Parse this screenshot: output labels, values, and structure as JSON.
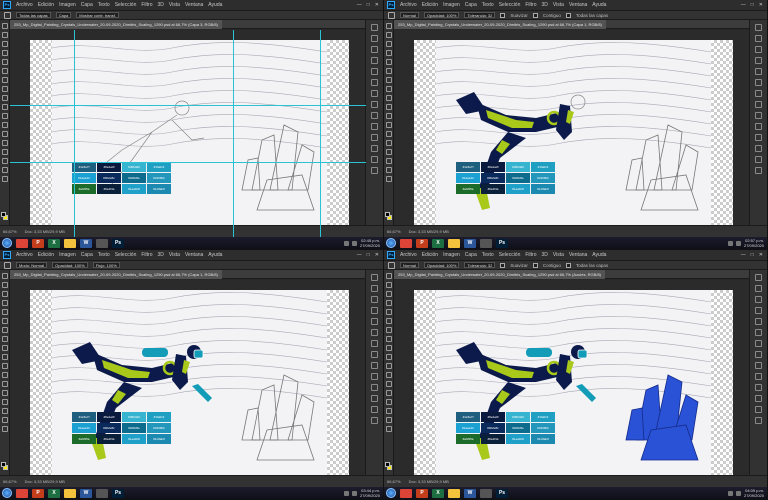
{
  "app": {
    "menu": [
      "Archivo",
      "Edición",
      "Imagen",
      "Capa",
      "Texto",
      "Selección",
      "Filtro",
      "3D",
      "Vista",
      "Ventana",
      "Ayuda"
    ],
    "window_controls": [
      "—",
      "□",
      "✕"
    ],
    "logo": "Ps"
  },
  "panes": [
    {
      "options": {
        "tool_label": "Todas las capas",
        "field1": "Capa",
        "field2": "Mostrar contr. transf."
      },
      "doc_tab": "253_Mp_Digital_Painting_Crystals_Underwater_20-09-2020_Dimitris_Scaling_1290.psd al 66,7% (Capa 3, RGB/8)",
      "zoom": "66,67%",
      "status": "Doc: 3,33 MB/29,9 MB",
      "time": "02:45 p.m.",
      "date": "27/09/2020"
    },
    {
      "options": {
        "tool_label": "Normal",
        "field1": "Opacidad: 100%",
        "field2": "Tolerancia: 32"
      },
      "checks": [
        "Suavizar",
        "Contiguo",
        "Todas las capas"
      ],
      "doc_tab": "253_Mp_Digital_Painting_Crystals_Underwater_20-09-2020_Dimitris_Scaling_1290.psd al 66,7% (Capa 1, RGB/8)",
      "zoom": "66,67%",
      "status": "Doc: 3,33 MB/29,9 MB",
      "time": "02:57 p.m.",
      "date": "27/09/2020"
    },
    {
      "options": {
        "tool_label": "Modo: Normal",
        "field1": "Opacidad: 100%",
        "field2": "Flujo: 100%"
      },
      "doc_tab": "253_Mp_Digital_Painting_Crystals_Underwater_20-09-2020_Dimitris_Scaling_1290.psd al 66,7% (Capa 1, RGB/8)",
      "zoom": "66,67%",
      "status": "Doc: 3,33 MB/29,9 MB",
      "time": "03:44 p.m.",
      "date": "27/09/2020"
    },
    {
      "options": {
        "tool_label": "Normal",
        "field1": "Opacidad: 100%",
        "field2": "Tolerancia: 32"
      },
      "checks": [
        "Suavizar",
        "Contiguo",
        "Todas las capas"
      ],
      "doc_tab": "253_Mp_Digital_Painting_Crystals_Underwater_20-09-2020_Dimitris_Scaling_1290.psd al 66,7% (Azules, RGB/8)",
      "zoom": "66,67%",
      "status": "Doc: 3,33 MB/29,9 MB",
      "time": "04:09 p.m.",
      "date": "27/09/2020"
    }
  ],
  "palette": [
    {
      "code": "#1e5e7f",
      "color": "#1e5e7f"
    },
    {
      "code": "#0a1a3f",
      "color": "#0a1a3f"
    },
    {
      "code": "#36b4d0",
      "color": "#36b4d0"
    },
    {
      "code": "#1fa0c3",
      "color": "#1fa0c3"
    },
    {
      "code": "#1aa1d2",
      "color": "#1aa1d2"
    },
    {
      "code": "#0b2a5c",
      "color": "#0b2a5c"
    },
    {
      "code": "#0d6c8e",
      "color": "#0d6c8e"
    },
    {
      "code": "#2296bb",
      "color": "#2296bb"
    },
    {
      "code": "#a4f45a",
      "color": "#1d6b2a"
    },
    {
      "code": "#0a1f3a",
      "color": "#0a1f3a"
    },
    {
      "code": "#1ea0c8",
      "color": "#1ea0c8"
    },
    {
      "code": "#1c8ab0",
      "color": "#1c8ab0"
    }
  ],
  "taskbar_icons": [
    {
      "name": "chrome",
      "label": "",
      "color": "#db4437"
    },
    {
      "name": "powerpoint",
      "label": "P",
      "color": "#c43e1c"
    },
    {
      "name": "excel",
      "label": "X",
      "color": "#1d6f42"
    },
    {
      "name": "explorer",
      "label": "",
      "color": "#f3c23c"
    },
    {
      "name": "word",
      "label": "W",
      "color": "#2b579a"
    },
    {
      "name": "app",
      "label": "",
      "color": "#555"
    },
    {
      "name": "photoshop",
      "label": "Ps",
      "color": "#001e36"
    }
  ],
  "colors": {
    "suit_dark": "#0b1a4a",
    "suit_green": "#a8c81a",
    "tank_teal": "#129cb8",
    "crystal_blue": "#2a52d6",
    "guide_cyan": "#29c3d6"
  }
}
